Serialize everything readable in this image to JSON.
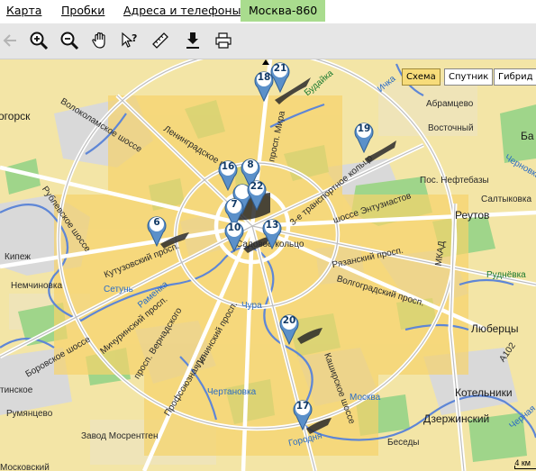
{
  "tabs": {
    "map": "Карта",
    "traffic": "Пробки",
    "addresses": "Адреса и телефоны",
    "city": "Москва-860"
  },
  "toolbar": {
    "icons": [
      "back-arrow-icon",
      "zoom-in-icon",
      "zoom-out-icon",
      "hand-icon",
      "query-icon",
      "ruler-icon",
      "download-icon",
      "print-icon"
    ]
  },
  "map_controls": {
    "scheme": "Схема",
    "satellite": "Спутник",
    "hybrid": "Гибрид"
  },
  "markers": [
    "21",
    "18",
    "19",
    "16",
    "8",
    "22",
    "7",
    "6",
    "10",
    "13",
    "20",
    "17"
  ],
  "labels": {
    "bottom_left_1": "огорск",
    "volokolamskoe": "Волоколамское шоссе",
    "leningradskoe": "Ленинградское ш.",
    "mira": "просп. Мира",
    "budayka": "Будайка",
    "ichka": "Ичка",
    "abramtsevo": "Абрамцево",
    "vostochny": "Восточный",
    "ba": "Ба",
    "transport_ring": "3-е транспортное кольцо",
    "entuziastov": "шоссе Энтузиастов",
    "pos_neftebazy": "Пос. Нефтебазы",
    "saltykovka": "Салтыковка",
    "chernovka": "Черновка",
    "reutov": "Реутов",
    "rublevskoe": "Рублевское шоссе",
    "kutuzovsky": "Кутузовский просп.",
    "kitezh": "Кипеж",
    "nemchinovka": "Немчиновка",
    "setun": "Сетунь",
    "ramenka": "Раменка",
    "sadovoe": "Садовое кольцо",
    "ryazansky": "Рязанский просп.",
    "mkad": "МКАД",
    "rudnevka": "Руднёвка",
    "volgogradsky": "Волгоградский просп.",
    "lyubertsy": "Люберцы",
    "michurinsky": "Мичуринский просп.",
    "vernadskogo": "просп. Вернадского",
    "leninsky": "Ленинский просп.",
    "profsoyuznaya": "Профсоюзная ул.",
    "borovskoe": "Боровское шоссе",
    "chura": "Чура",
    "kashirskoe": "Каширское шоссе",
    "a102": "А102",
    "tinskoe": "тинское",
    "rumyantsevo": "Румянцево",
    "chertanovka": "Чертановка",
    "moskva_river": "Москва",
    "kotelniki": "Котельники",
    "dzerzhinsky": "Дзержинский",
    "zavod": "Завод Мосрентген",
    "gorodnya": "Городня",
    "besedy": "Беседы",
    "moskovsky": "Московский",
    "chernaya": "Черная",
    "scale": "4 км"
  }
}
